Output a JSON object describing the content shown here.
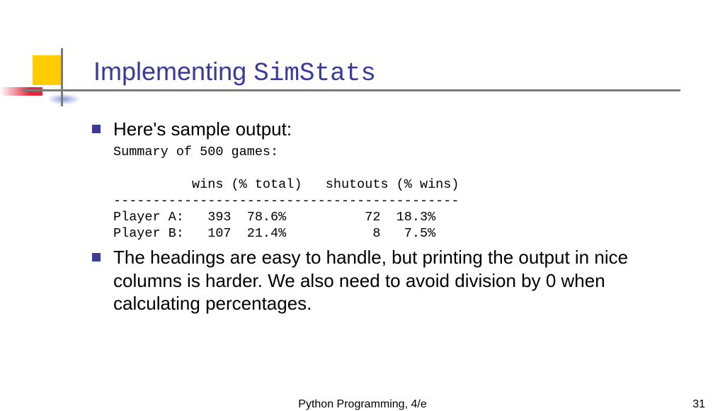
{
  "title": {
    "prefix": "Implementing ",
    "mono": "SimStats"
  },
  "bullets": [
    "Here's sample output:",
    "The headings are easy to handle, but printing the output in nice columns is harder. We also need to avoid division by 0 when calculating percentages."
  ],
  "code": "Summary of 500 games:\n\n          wins (% total)   shutouts (% wins)\n--------------------------------------------\nPlayer A:   393  78.6%          72  18.3%\nPlayer B:   107  21.4%           8   7.5%",
  "footer": {
    "center": "Python Programming, 4/e",
    "page": "31"
  },
  "chart_data": {
    "type": "table",
    "title": "Summary of 500 games",
    "columns": [
      "Player",
      "wins",
      "% total",
      "shutouts",
      "% wins"
    ],
    "rows": [
      {
        "Player": "Player A",
        "wins": 393,
        "% total": 78.6,
        "shutouts": 72,
        "% wins": 18.3
      },
      {
        "Player": "Player B",
        "wins": 107,
        "% total": 21.4,
        "shutouts": 8,
        "% wins": 7.5
      }
    ],
    "total_games": 500
  }
}
